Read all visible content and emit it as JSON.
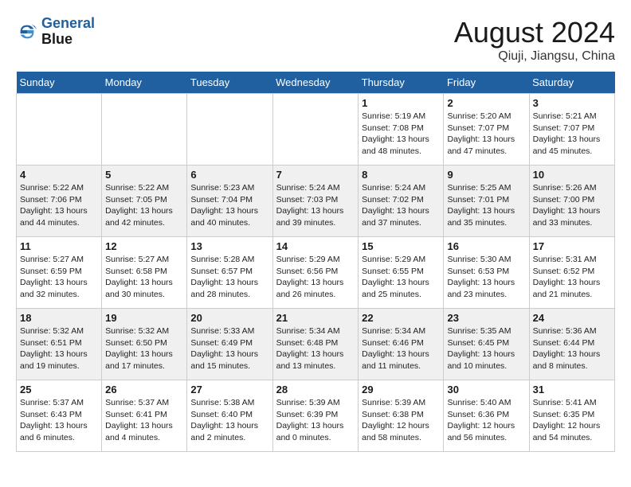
{
  "header": {
    "logo_line1": "General",
    "logo_line2": "Blue",
    "month_year": "August 2024",
    "location": "Qiuji, Jiangsu, China"
  },
  "weekdays": [
    "Sunday",
    "Monday",
    "Tuesday",
    "Wednesday",
    "Thursday",
    "Friday",
    "Saturday"
  ],
  "weeks": [
    [
      {
        "day": "",
        "sunrise": "",
        "sunset": "",
        "daylight": ""
      },
      {
        "day": "",
        "sunrise": "",
        "sunset": "",
        "daylight": ""
      },
      {
        "day": "",
        "sunrise": "",
        "sunset": "",
        "daylight": ""
      },
      {
        "day": "",
        "sunrise": "",
        "sunset": "",
        "daylight": ""
      },
      {
        "day": "1",
        "sunrise": "Sunrise: 5:19 AM",
        "sunset": "Sunset: 7:08 PM",
        "daylight": "Daylight: 13 hours and 48 minutes."
      },
      {
        "day": "2",
        "sunrise": "Sunrise: 5:20 AM",
        "sunset": "Sunset: 7:07 PM",
        "daylight": "Daylight: 13 hours and 47 minutes."
      },
      {
        "day": "3",
        "sunrise": "Sunrise: 5:21 AM",
        "sunset": "Sunset: 7:07 PM",
        "daylight": "Daylight: 13 hours and 45 minutes."
      }
    ],
    [
      {
        "day": "4",
        "sunrise": "Sunrise: 5:22 AM",
        "sunset": "Sunset: 7:06 PM",
        "daylight": "Daylight: 13 hours and 44 minutes."
      },
      {
        "day": "5",
        "sunrise": "Sunrise: 5:22 AM",
        "sunset": "Sunset: 7:05 PM",
        "daylight": "Daylight: 13 hours and 42 minutes."
      },
      {
        "day": "6",
        "sunrise": "Sunrise: 5:23 AM",
        "sunset": "Sunset: 7:04 PM",
        "daylight": "Daylight: 13 hours and 40 minutes."
      },
      {
        "day": "7",
        "sunrise": "Sunrise: 5:24 AM",
        "sunset": "Sunset: 7:03 PM",
        "daylight": "Daylight: 13 hours and 39 minutes."
      },
      {
        "day": "8",
        "sunrise": "Sunrise: 5:24 AM",
        "sunset": "Sunset: 7:02 PM",
        "daylight": "Daylight: 13 hours and 37 minutes."
      },
      {
        "day": "9",
        "sunrise": "Sunrise: 5:25 AM",
        "sunset": "Sunset: 7:01 PM",
        "daylight": "Daylight: 13 hours and 35 minutes."
      },
      {
        "day": "10",
        "sunrise": "Sunrise: 5:26 AM",
        "sunset": "Sunset: 7:00 PM",
        "daylight": "Daylight: 13 hours and 33 minutes."
      }
    ],
    [
      {
        "day": "11",
        "sunrise": "Sunrise: 5:27 AM",
        "sunset": "Sunset: 6:59 PM",
        "daylight": "Daylight: 13 hours and 32 minutes."
      },
      {
        "day": "12",
        "sunrise": "Sunrise: 5:27 AM",
        "sunset": "Sunset: 6:58 PM",
        "daylight": "Daylight: 13 hours and 30 minutes."
      },
      {
        "day": "13",
        "sunrise": "Sunrise: 5:28 AM",
        "sunset": "Sunset: 6:57 PM",
        "daylight": "Daylight: 13 hours and 28 minutes."
      },
      {
        "day": "14",
        "sunrise": "Sunrise: 5:29 AM",
        "sunset": "Sunset: 6:56 PM",
        "daylight": "Daylight: 13 hours and 26 minutes."
      },
      {
        "day": "15",
        "sunrise": "Sunrise: 5:29 AM",
        "sunset": "Sunset: 6:55 PM",
        "daylight": "Daylight: 13 hours and 25 minutes."
      },
      {
        "day": "16",
        "sunrise": "Sunrise: 5:30 AM",
        "sunset": "Sunset: 6:53 PM",
        "daylight": "Daylight: 13 hours and 23 minutes."
      },
      {
        "day": "17",
        "sunrise": "Sunrise: 5:31 AM",
        "sunset": "Sunset: 6:52 PM",
        "daylight": "Daylight: 13 hours and 21 minutes."
      }
    ],
    [
      {
        "day": "18",
        "sunrise": "Sunrise: 5:32 AM",
        "sunset": "Sunset: 6:51 PM",
        "daylight": "Daylight: 13 hours and 19 minutes."
      },
      {
        "day": "19",
        "sunrise": "Sunrise: 5:32 AM",
        "sunset": "Sunset: 6:50 PM",
        "daylight": "Daylight: 13 hours and 17 minutes."
      },
      {
        "day": "20",
        "sunrise": "Sunrise: 5:33 AM",
        "sunset": "Sunset: 6:49 PM",
        "daylight": "Daylight: 13 hours and 15 minutes."
      },
      {
        "day": "21",
        "sunrise": "Sunrise: 5:34 AM",
        "sunset": "Sunset: 6:48 PM",
        "daylight": "Daylight: 13 hours and 13 minutes."
      },
      {
        "day": "22",
        "sunrise": "Sunrise: 5:34 AM",
        "sunset": "Sunset: 6:46 PM",
        "daylight": "Daylight: 13 hours and 11 minutes."
      },
      {
        "day": "23",
        "sunrise": "Sunrise: 5:35 AM",
        "sunset": "Sunset: 6:45 PM",
        "daylight": "Daylight: 13 hours and 10 minutes."
      },
      {
        "day": "24",
        "sunrise": "Sunrise: 5:36 AM",
        "sunset": "Sunset: 6:44 PM",
        "daylight": "Daylight: 13 hours and 8 minutes."
      }
    ],
    [
      {
        "day": "25",
        "sunrise": "Sunrise: 5:37 AM",
        "sunset": "Sunset: 6:43 PM",
        "daylight": "Daylight: 13 hours and 6 minutes."
      },
      {
        "day": "26",
        "sunrise": "Sunrise: 5:37 AM",
        "sunset": "Sunset: 6:41 PM",
        "daylight": "Daylight: 13 hours and 4 minutes."
      },
      {
        "day": "27",
        "sunrise": "Sunrise: 5:38 AM",
        "sunset": "Sunset: 6:40 PM",
        "daylight": "Daylight: 13 hours and 2 minutes."
      },
      {
        "day": "28",
        "sunrise": "Sunrise: 5:39 AM",
        "sunset": "Sunset: 6:39 PM",
        "daylight": "Daylight: 13 hours and 0 minutes."
      },
      {
        "day": "29",
        "sunrise": "Sunrise: 5:39 AM",
        "sunset": "Sunset: 6:38 PM",
        "daylight": "Daylight: 12 hours and 58 minutes."
      },
      {
        "day": "30",
        "sunrise": "Sunrise: 5:40 AM",
        "sunset": "Sunset: 6:36 PM",
        "daylight": "Daylight: 12 hours and 56 minutes."
      },
      {
        "day": "31",
        "sunrise": "Sunrise: 5:41 AM",
        "sunset": "Sunset: 6:35 PM",
        "daylight": "Daylight: 12 hours and 54 minutes."
      }
    ]
  ]
}
